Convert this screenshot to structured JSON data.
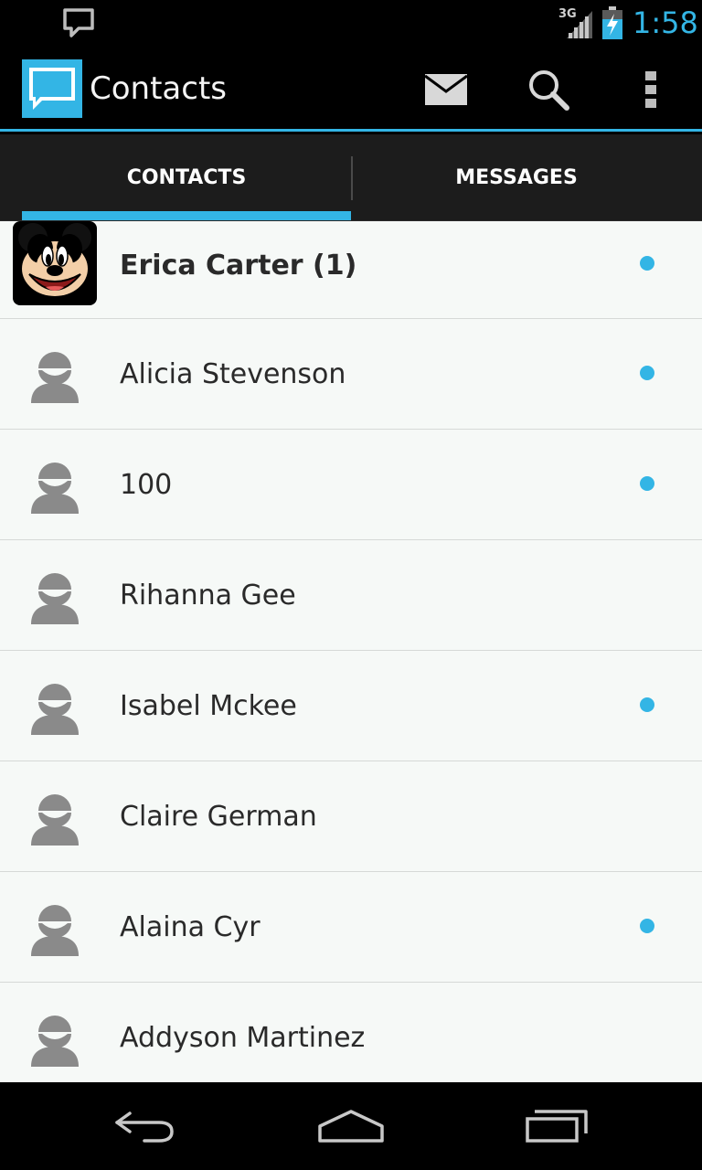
{
  "status_bar": {
    "time": "1:58",
    "network_type": "3G",
    "notification_icon": "message-notification-icon",
    "signal_icon": "cell-signal-icon",
    "battery_icon": "battery-charging-icon",
    "accent_color": "#33b5e5"
  },
  "action_bar": {
    "title": "Contacts",
    "app_icon": "chat-bubble-icon",
    "actions": [
      {
        "id": "compose",
        "icon": "envelope-icon"
      },
      {
        "id": "search",
        "icon": "search-icon"
      },
      {
        "id": "overflow",
        "icon": "overflow-menu-icon"
      }
    ]
  },
  "tabs": [
    {
      "label": "CONTACTS",
      "selected": true
    },
    {
      "label": "MESSAGES",
      "selected": false
    }
  ],
  "contacts": [
    {
      "name": "Erica Carter (1)",
      "avatar": "mickey-mouse-photo",
      "unread": true,
      "bold": true
    },
    {
      "name": "Alicia Stevenson",
      "avatar": "default-person-icon",
      "unread": true
    },
    {
      "name": "100",
      "avatar": "default-person-icon",
      "unread": true
    },
    {
      "name": "Rihanna Gee",
      "avatar": "default-person-icon",
      "unread": false
    },
    {
      "name": "Isabel Mckee",
      "avatar": "default-person-icon",
      "unread": true
    },
    {
      "name": "Claire German",
      "avatar": "default-person-icon",
      "unread": false
    },
    {
      "name": "Alaina Cyr",
      "avatar": "default-person-icon",
      "unread": true
    },
    {
      "name": "Addyson Martinez",
      "avatar": "default-person-icon",
      "unread": false
    }
  ],
  "nav_bar": {
    "back_icon": "back-arrow-icon",
    "home_icon": "home-icon",
    "recents_icon": "recent-apps-icon"
  },
  "colors": {
    "unread_dot": "#33b5e5",
    "list_background": "#f6f9f7",
    "avatar_gray": "#8a8a8a"
  }
}
